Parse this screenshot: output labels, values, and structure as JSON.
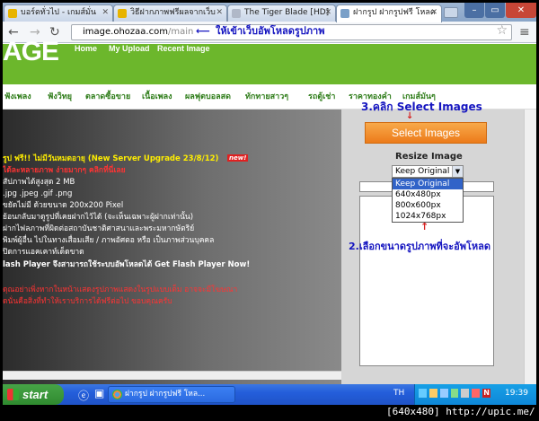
{
  "browser": {
    "tabs": [
      {
        "title": "บอร์ดทั่วไป - เกมส์มั่น",
        "fav_color": "#e8b400"
      },
      {
        "title": "วิธีฝากภาพฟรีผลจากเว็บ",
        "fav_color": "#e8b400"
      },
      {
        "title": "The Tiger Blade [HD]",
        "fav_color": "#b0b8c8"
      },
      {
        "title": "ฝากรูป ฝากรูปฟรี โหลด",
        "fav_color": "#7aa0c8"
      }
    ],
    "address_host": "image.ohozaa.com",
    "address_path": "/main",
    "back_icon": "back-arrow-icon",
    "forward_icon": "forward-arrow-icon",
    "reload_icon": "reload-icon",
    "star_icon": "star-icon",
    "menu_icon": "wrench-menu-icon"
  },
  "site": {
    "logo": "AGE",
    "nav": [
      "Home",
      "My Upload",
      "Recent Image"
    ],
    "categories": [
      "ฟังเพลง",
      "ฟังวิทยุ",
      "ตลาดซื้อขาย",
      "เนื้อเพลง",
      "ผลฟุตบอลสด",
      "ทักทายสาวๆ",
      "รถตู้เช่า",
      "ราคาทองคำ",
      "เกมส์มันๆ"
    ],
    "info_lines": [
      {
        "text": "รูป ฟรี!! ไม่มีวันหมดอายุ (New Server Upgrade 23/8/12)",
        "color": "#ffee00",
        "bold": true
      },
      {
        "text": "ได้ละหลายภาพ ง่ายมากๆ คลิกที่นี่เลย",
        "color": "#ff3333",
        "bold": true
      },
      {
        "text": "สัปภาพได้สูงสุด 2 MB",
        "color": "#ffffff",
        "bold": false
      },
      {
        "text": ".jpg .jpeg .gif .png",
        "color": "#ffffff",
        "bold": false
      },
      {
        "text": "ขยัดไม่มี ด้วยขนาด 200x200 Pixel",
        "color": "#ffffff",
        "bold": false
      },
      {
        "text": "ย้อนกลับมาดูรูปที่เคยฝากไว้ได้ (จะเห็นเฉพาะผู้ฝากเท่านั้น)",
        "color": "#ffffff",
        "bold": false
      },
      {
        "text": "ฝากไฟลภาพที่ผิดต่อสถาบันชาติศาสนาและพระมหากษัตริย์",
        "color": "#ffffff",
        "bold": false
      },
      {
        "text": "พิมพ์ผู้อื่น ไปในทางเสื่อมเสีย / ภาพอัศตอ หรือ เป็นภาพส่วนบุคคล",
        "color": "#ffffff",
        "bold": false
      },
      {
        "text": "ปิดการแอคเคาท์เด็ดขาด",
        "color": "#ffffff",
        "bold": false
      },
      {
        "text": "lash Player จึงสามารถใช้ระบบอัพโหลดได้ Get Flash Player Now!",
        "color": "#ffffff",
        "bold": true
      },
      {
        "text": "ดุณอย่าเพิ่งหากในหน้าแสดงรูปภาพแสดงในรูปแบบเต็ม อาจจะมีโฆษณา",
        "color": "#ff3333",
        "bold": false
      },
      {
        "text": "ดนั่นคือสิ่งที่ทำให้เราบริการได้ฟรีต่อไป ขอบคุณครับ",
        "color": "#ff3333",
        "bold": false
      }
    ],
    "new_badge": "new!",
    "select_button": "Select Images",
    "resize_label": "Resize Image",
    "resize_selected": "Keep Original",
    "resize_options": [
      "Keep Original",
      "640x480px",
      "800x600px",
      "1024x768px"
    ]
  },
  "annotations": {
    "top": "ให้เข้าเว็บอัพโหลดรูปภาพ",
    "step3": "3.คลิก Select Images",
    "step2": "2.เลือกขนาดรูปภาพที่จะอัพโหลด"
  },
  "taskbar": {
    "start": "start",
    "task_title": "ฝากรูป ฝากรูปฟรี โหล...",
    "lang": "TH",
    "clock": "19:39"
  },
  "footer": "[640x480] http://upic.me/",
  "colors": {
    "site_green": "#6cb72c",
    "orange_button": "#f08c2a",
    "annotation_blue": "#1515c0"
  }
}
